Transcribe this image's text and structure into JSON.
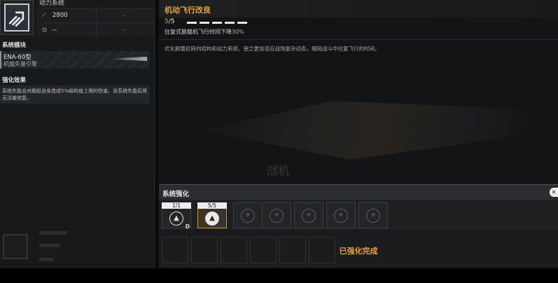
{
  "left": {
    "subsystem_title": "动力系统",
    "stats": [
      {
        "icon": "attack-icon",
        "value": "2800",
        "extra": "--"
      },
      {
        "icon": "armor-icon",
        "value": "--",
        "extra": "--"
      }
    ],
    "module_heading": "系统模块",
    "module": {
      "name": "ENA-60型",
      "desc": "机载矢量引擎"
    },
    "effect_heading": "强化效果",
    "effect_text": "系统失能会对舰船自身造成5%结构值上限的伤害。该系统失能后将无法被修复。"
  },
  "main": {
    "title": "机动飞行改良",
    "level_current": "5",
    "level_max": "/5",
    "pips": 5,
    "bonus_prefix": "往复式舰载机飞行时间下降",
    "bonus_value": "30%",
    "description": "优化舰载机转向结构和动力系统，使之更加适应战场复杂动态，缩短战斗中往复飞行的时间。",
    "bg_text": "战机"
  },
  "tray": {
    "title": "系统强化",
    "close_icon": "close-icon",
    "slots": [
      {
        "level": "1/1",
        "tag": "D",
        "state": "unlocked"
      },
      {
        "level": "5/5",
        "tag": "",
        "state": "active"
      },
      {
        "level": "",
        "tag": "",
        "state": "locked"
      },
      {
        "level": "",
        "tag": "",
        "state": "locked"
      },
      {
        "level": "",
        "tag": "",
        "state": "locked"
      },
      {
        "level": "",
        "tag": "",
        "state": "locked"
      },
      {
        "level": "",
        "tag": "",
        "state": "locked"
      }
    ],
    "status": "已强化完成"
  },
  "colors": {
    "accent": "#e8a33a",
    "panel": "#17191b"
  }
}
